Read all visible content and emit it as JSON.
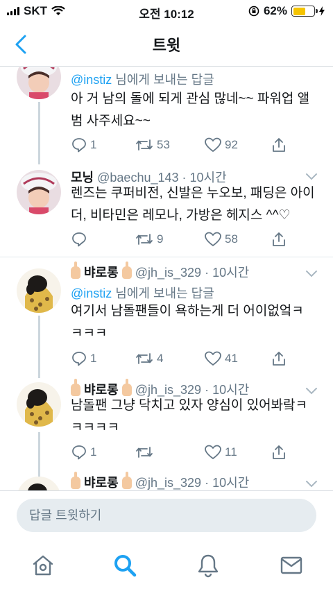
{
  "status": {
    "carrier": "SKT",
    "time": "오전 10:12",
    "battery": "62%",
    "battery_level": 0.62,
    "battery_color": "#f5c400"
  },
  "nav": {
    "title": "트윗"
  },
  "colors": {
    "accent": "#1da1f2",
    "secondary_text": "#657786",
    "text": "#14171a"
  },
  "tweets": [
    {
      "reply_to": {
        "mention": "@instiz",
        "suffix": " 님에게 보내는 답글"
      },
      "text": "아 거 남의 돌에 되게 관심 많네~~ 파워업 앨범 사주세요~~",
      "replies": "1",
      "retweets": "53",
      "likes": "92"
    },
    {
      "name": "모닝",
      "handle": "@baechu_143",
      "time": " · 10시간",
      "text": "렌즈는 쿠퍼비전, 신발은 누오보, 패딩은 아이더, 비타민은 레모나, 가방은 헤지스 ^^♡",
      "replies": "",
      "retweets": "9",
      "likes": "58"
    },
    {
      "name": "뱌로롱",
      "handle": "@jh_is_329",
      "time": " · 10시간",
      "reply_to": {
        "mention": "@instiz",
        "suffix": " 님에게 보내는 답글"
      },
      "text": "여기서 남돌팬들이 욕하는게 더 어이없엌ㅋㅋㅋㅋ",
      "replies": "1",
      "retweets": "4",
      "likes": "41"
    },
    {
      "name": "뱌로롱",
      "handle": "@jh_is_329",
      "time": " · 10시간",
      "text": "남돌팬 그냥 닥치고 있자 양심이 있어봐랔ㅋㅋㅋㅋㅋ",
      "replies": "1",
      "retweets": "",
      "likes": "11"
    },
    {
      "name": "뱌로롱",
      "handle": "@jh_is_329",
      "time": " · 10시간"
    }
  ],
  "reply_bar": {
    "placeholder": "답글 트윗하기"
  },
  "tabs": [
    "home-icon",
    "search-icon",
    "notifications-icon",
    "messages-icon"
  ]
}
